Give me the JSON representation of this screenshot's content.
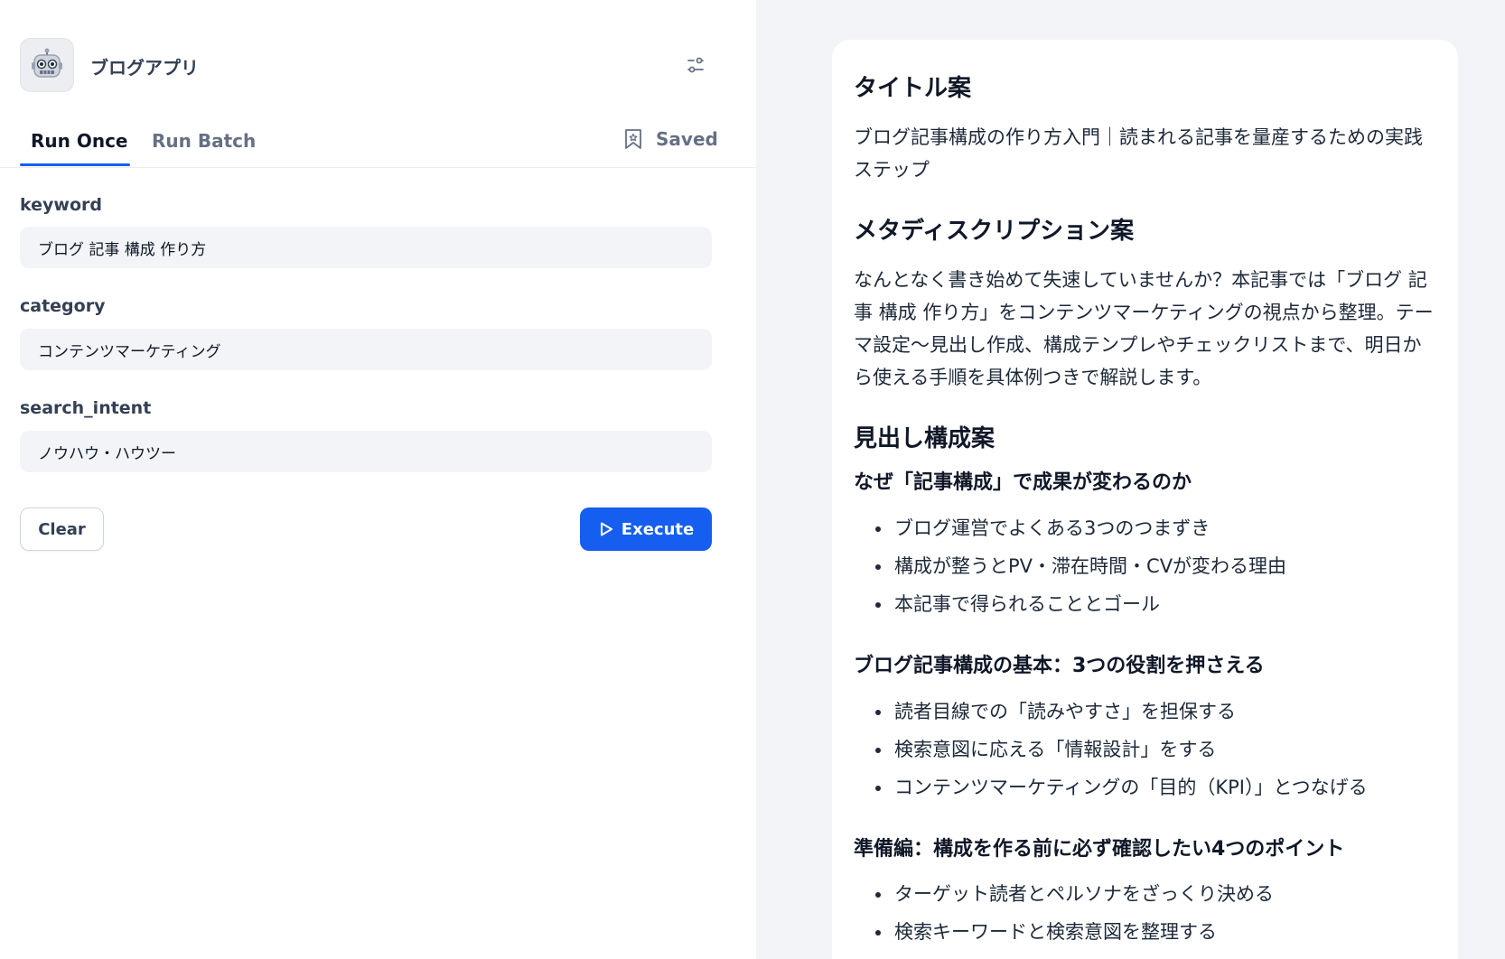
{
  "app": {
    "name": "ブログアプリ",
    "icon": "robot-icon"
  },
  "tabs": {
    "run_once": "Run Once",
    "run_batch": "Run Batch",
    "saved": "Saved"
  },
  "fields": [
    {
      "label": "keyword",
      "value": "ブログ 記事 構成 作り方"
    },
    {
      "label": "category",
      "value": "コンテンツマーケティング"
    },
    {
      "label": "search_intent",
      "value": "ノウハウ・ハウツー"
    }
  ],
  "buttons": {
    "clear": "Clear",
    "execute": "Execute"
  },
  "colors": {
    "accent": "#155eef",
    "right_bg": "#f2f4f7",
    "input_bg": "#f2f4f7"
  },
  "output": {
    "title_heading": "タイトル案",
    "title_text": "ブログ記事構成の作り方入門｜読まれる記事を量産するための実践ステップ",
    "meta_heading": "メタディスクリプション案",
    "meta_text": "なんとなく書き始めて失速していませんか？本記事では「ブログ 記事 構成 作り方」をコンテンツマーケティングの視点から整理。テーマ設定〜見出し作成、構成テンプレやチェックリストまで、明日から使える手順を具体例つきで解説します。",
    "outline_heading": "見出し構成案",
    "sections": [
      {
        "heading": "なぜ「記事構成」で成果が変わるのか",
        "items": [
          "ブログ運営でよくある3つのつまずき",
          "構成が整うとPV・滞在時間・CVが変わる理由",
          "本記事で得られることとゴール"
        ]
      },
      {
        "heading": "ブログ記事構成の基本：3つの役割を押さえる",
        "items": [
          "読者目線での「読みやすさ」を担保する",
          "検索意図に応える「情報設計」をする",
          "コンテンツマーケティングの「目的（KPI）」とつなげる"
        ]
      },
      {
        "heading": "準備編：構成を作る前に必ず確認したい4つのポイント",
        "items": [
          "ターゲット読者とペルソナをざっくり決める",
          "検索キーワードと検索意図を整理する"
        ]
      }
    ]
  }
}
